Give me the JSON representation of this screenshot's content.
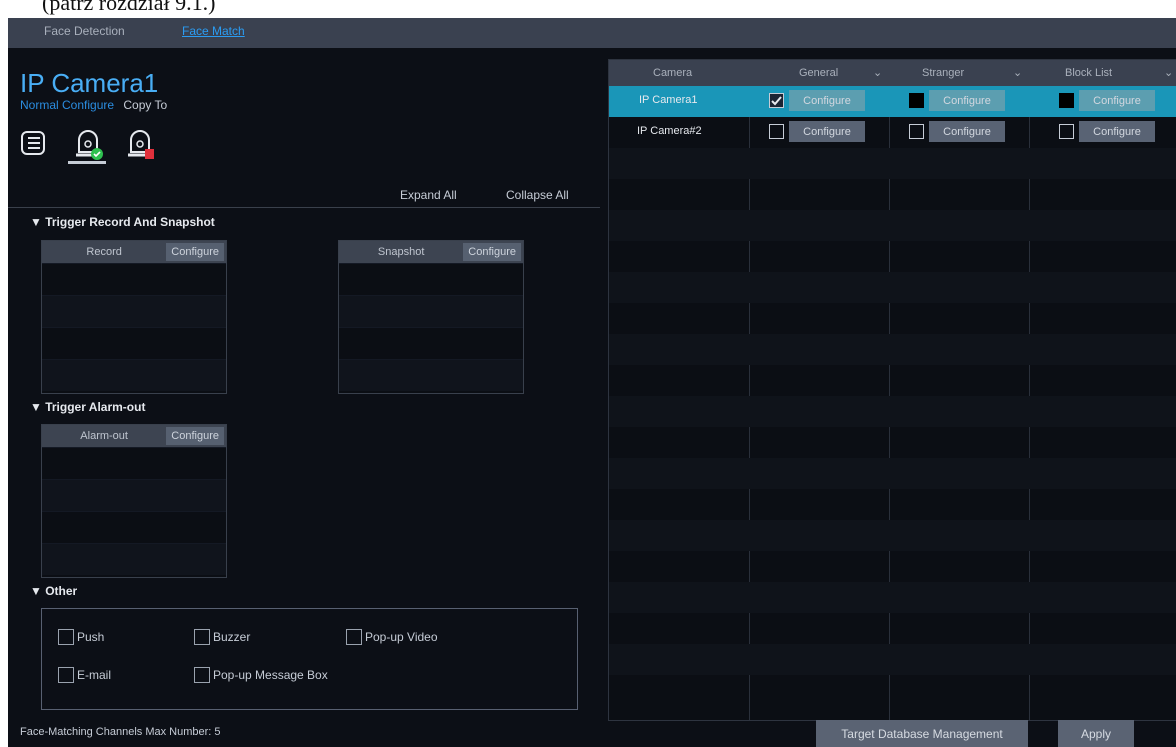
{
  "doc_caption": "(patrz rozdział 9.1.)",
  "tabs": [
    {
      "label": "Face Detection"
    },
    {
      "label": "Face Match"
    }
  ],
  "left": {
    "title": "IP Camera1",
    "normal_configure": "Normal Configure",
    "copy_to": "Copy To",
    "expand_all": "Expand All",
    "collapse_all": "Collapse All",
    "sections": {
      "trigger_record": "▼ Trigger Record And Snapshot",
      "trigger_alarm": "▼ Trigger Alarm-out",
      "other": "▼ Other"
    },
    "record_table": {
      "header": "Record",
      "configure": "Configure"
    },
    "snapshot_table": {
      "header": "Snapshot",
      "configure": "Configure"
    },
    "alarm_table": {
      "header": "Alarm-out",
      "configure": "Configure"
    },
    "other_options": {
      "push": "Push",
      "buzzer": "Buzzer",
      "popup_video": "Pop-up Video",
      "email": "E-mail",
      "popup_message": "Pop-up Message Box"
    },
    "max_number": "Face-Matching Channels Max Number: 5"
  },
  "right": {
    "columns": {
      "camera": "Camera",
      "general": "General",
      "stranger": "Stranger",
      "block_list": "Block List"
    },
    "rows": [
      {
        "camera": "IP Camera1",
        "general_checked": true,
        "stranger_state": "filled",
        "block_state": "filled",
        "configure": "Configure"
      },
      {
        "camera": "IP Camera#2",
        "general_checked": false,
        "stranger_state": "empty",
        "block_state": "empty",
        "configure": "Configure"
      }
    ]
  },
  "buttons": {
    "target_db": "Target Database Management",
    "apply": "Apply"
  },
  "icons": {
    "list": "list-icon",
    "trigger_ok": "alarm-trigger-check-icon",
    "trigger_err": "alarm-trigger-error-icon",
    "chevron": "chevron-down-icon"
  },
  "colors": {
    "accent": "#49aef5",
    "selected_row": "#1a96b8",
    "background": "#0c0f16"
  }
}
